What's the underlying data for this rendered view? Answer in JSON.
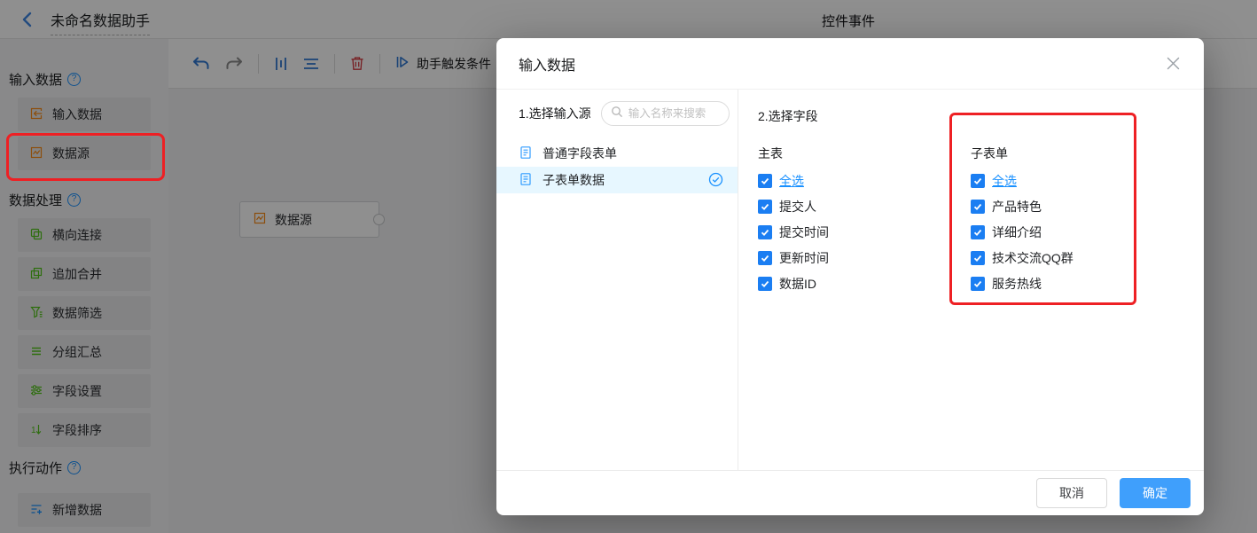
{
  "topbar": {
    "back_label": "未命名数据助手",
    "page_title": "控件事件"
  },
  "icons": {
    "help_glyph": "?"
  },
  "sidebar": {
    "sections": [
      {
        "title": "输入数据",
        "items": [
          {
            "label": "输入数据"
          },
          {
            "label": "数据源"
          }
        ]
      },
      {
        "title": "数据处理",
        "items": [
          {
            "label": "横向连接"
          },
          {
            "label": "追加合并"
          },
          {
            "label": "数据筛选"
          },
          {
            "label": "分组汇总"
          },
          {
            "label": "字段设置"
          },
          {
            "label": "字段排序"
          }
        ]
      },
      {
        "title": "执行动作",
        "items": [
          {
            "label": "新增数据"
          }
        ]
      }
    ]
  },
  "canvas": {
    "toolbar": {
      "trigger_label": "助手触发条件"
    },
    "node": {
      "label": "数据源"
    }
  },
  "modal": {
    "title": "输入数据",
    "step1_label": "1.选择输入源",
    "search": {
      "placeholder": "输入名称来搜索"
    },
    "sources": [
      {
        "label": "普通字段表单",
        "selected": false
      },
      {
        "label": "子表单数据",
        "selected": true
      }
    ],
    "step2_label": "2.选择字段",
    "field_groups": [
      {
        "title": "主表",
        "fields": [
          {
            "label": "全选"
          },
          {
            "label": "提交人"
          },
          {
            "label": "提交时间"
          },
          {
            "label": "更新时间"
          },
          {
            "label": "数据ID"
          }
        ]
      },
      {
        "title": "子表单",
        "fields": [
          {
            "label": "全选"
          },
          {
            "label": "产品特色"
          },
          {
            "label": "详细介绍"
          },
          {
            "label": "技术交流QQ群"
          },
          {
            "label": "服务热线"
          }
        ]
      }
    ],
    "cancel_label": "取消",
    "confirm_label": "确定"
  },
  "colors": {
    "accent_blue": "#1890ff",
    "checkbox_blue": "#1b7ef2",
    "confirm_blue": "#3f9ffc",
    "annotation_red": "#ee2024",
    "input_icon_orange": "#fa8c16",
    "process_icon_green": "#52c41a",
    "danger_red": "#d5383f",
    "selected_row_bg": "#e7f7ff"
  }
}
